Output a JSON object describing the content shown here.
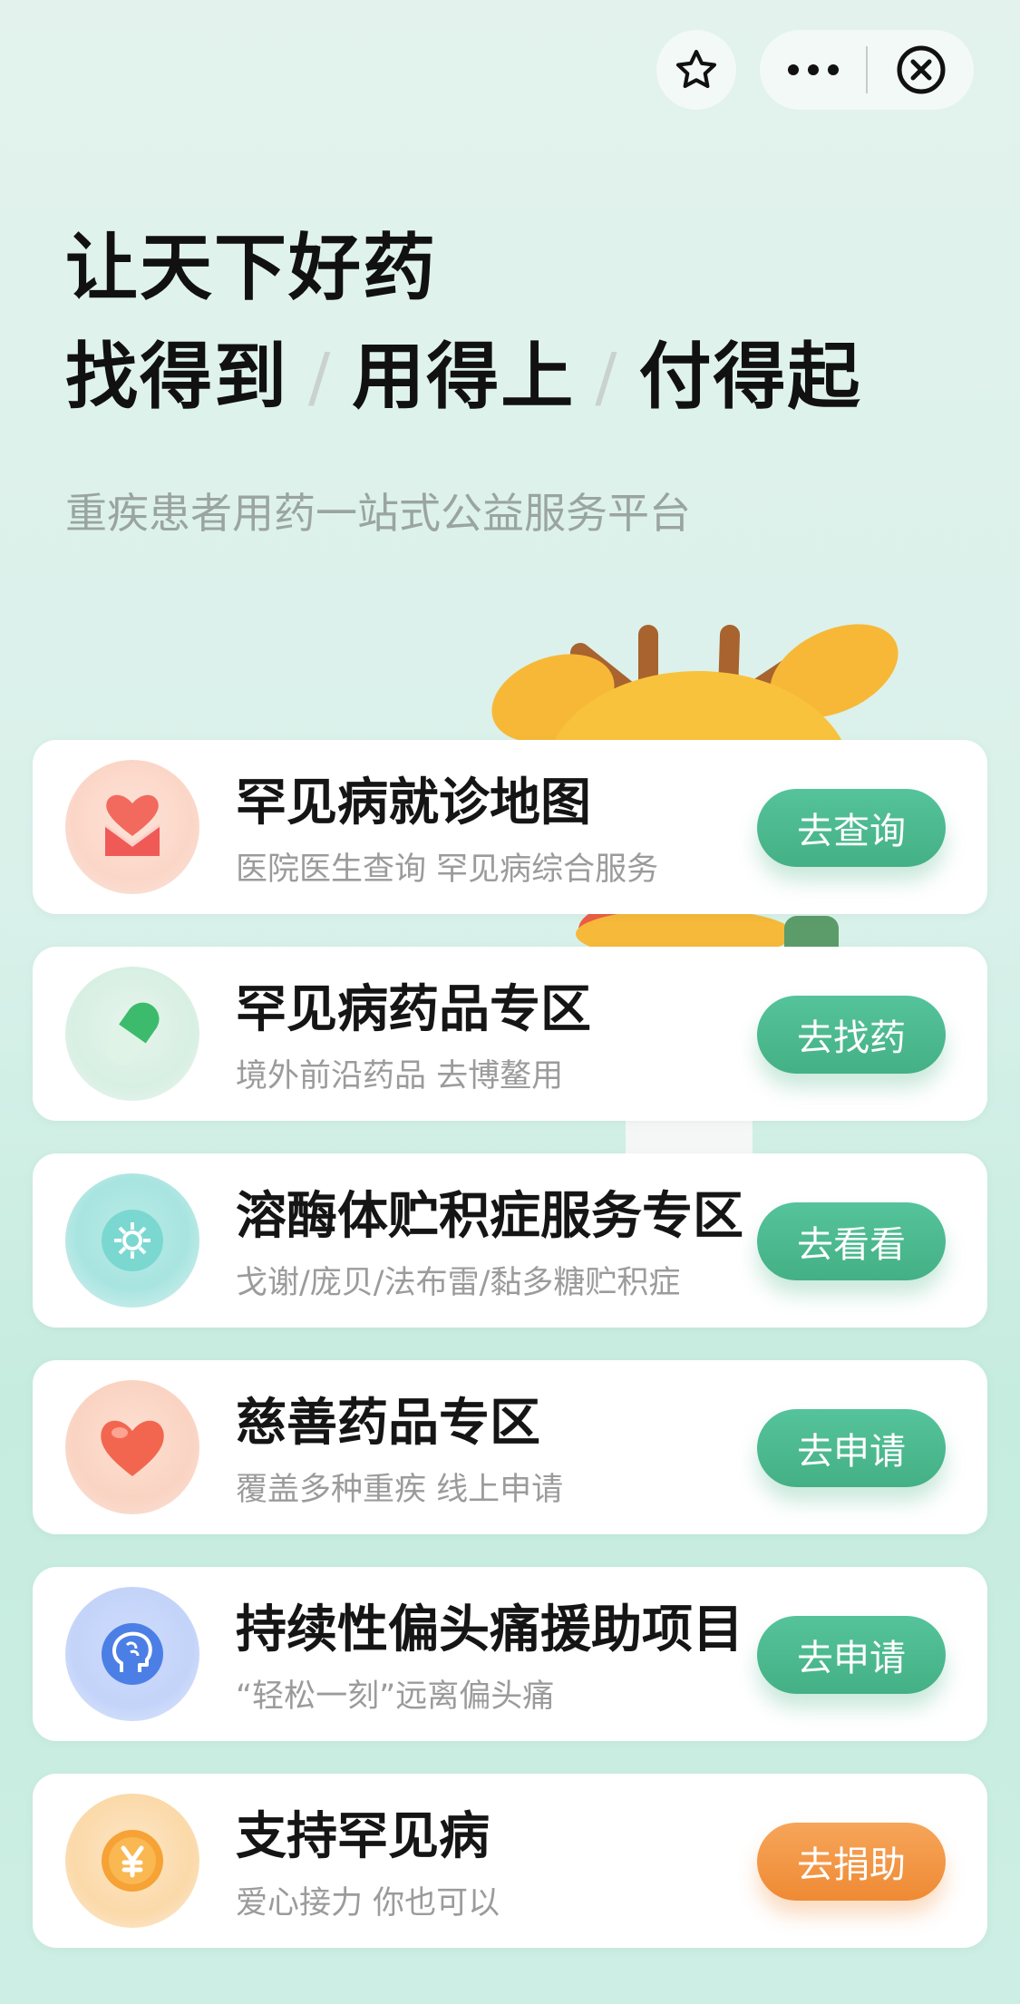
{
  "header": {
    "line1": "让天下好药",
    "line2_parts": [
      "找得到",
      "用得上",
      "付得起"
    ],
    "slash": "/",
    "subtitle": "重疾患者用药一站式公益服务平台"
  },
  "topbar": {
    "favorite_icon": "star-icon",
    "more_icon": "more-dots-icon",
    "close_icon": "close-circle-icon"
  },
  "colors": {
    "accent_green": "#4dbb90",
    "accent_orange": "#f29441"
  },
  "services": [
    {
      "icon": "heart-envelope-icon",
      "title": "罕见病就诊地图",
      "desc": "医院医生查询 罕见病综合服务",
      "action": "去查询",
      "action_color": "green"
    },
    {
      "icon": "capsule-pill-icon",
      "title": "罕见病药品专区",
      "desc": "境外前沿药品 去博鳌用",
      "action": "去找药",
      "action_color": "green"
    },
    {
      "icon": "cell-gear-icon",
      "title": "溶酶体贮积症服务专区",
      "desc": "戈谢/庞贝/法布雷/黏多糖贮积症",
      "action": "去看看",
      "action_color": "green"
    },
    {
      "icon": "heart-icon",
      "title": "慈善药品专区",
      "desc": "覆盖多种重疾 线上申请",
      "action": "去申请",
      "action_color": "green"
    },
    {
      "icon": "brain-head-icon",
      "title": "持续性偏头痛援助项目",
      "desc": "“轻松一刻”远离偏头痛",
      "action": "去申请",
      "action_color": "green"
    },
    {
      "icon": "yen-coin-icon",
      "title": "支持罕见病",
      "desc": "爱心接力 你也可以",
      "action": "去捐助",
      "action_color": "orange"
    }
  ]
}
